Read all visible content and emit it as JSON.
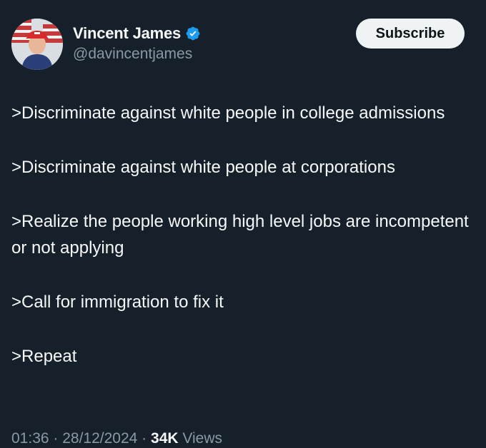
{
  "author": {
    "display_name": "Vincent James",
    "handle": "@davincentjames",
    "verified": true
  },
  "actions": {
    "subscribe_label": "Subscribe"
  },
  "tweet": {
    "paragraphs": [
      ">Discriminate against white people in college admissions",
      ">Discriminate against white people at corporations",
      ">Realize the people working high level jobs are incompetent or not applying",
      ">Call for immigration to fix it",
      ">Repeat"
    ]
  },
  "meta": {
    "time": "01:36",
    "separator": " · ",
    "date": "28/12/2024",
    "views_count": "34K",
    "views_label": "Views"
  },
  "colors": {
    "background": "#15202b",
    "text_primary": "#f7f9f9",
    "text_secondary": "#8b98a5",
    "verified_blue": "#1d9bf0",
    "button_bg": "#eff3f4"
  },
  "icons": {
    "verified": "verified-badge-icon"
  }
}
